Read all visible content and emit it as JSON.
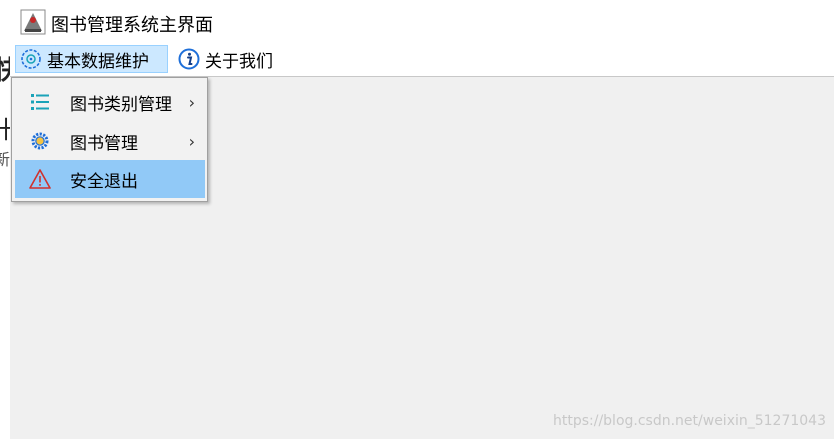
{
  "window": {
    "title": "图书管理系统主界面"
  },
  "menubar": {
    "menus": [
      {
        "label": "基本数据维护",
        "icon": "database-gear-icon"
      },
      {
        "label": "关于我们",
        "icon": "info-icon"
      }
    ]
  },
  "dropdown": {
    "items": [
      {
        "label": "图书类别管理",
        "icon": "list-icon",
        "arrow": "›"
      },
      {
        "label": "图书管理",
        "icon": "gear-icon",
        "arrow": "›"
      },
      {
        "label": "安全退出",
        "icon": "warning-icon"
      }
    ]
  },
  "background_window": {
    "glyphs": [
      "快",
      "十",
      "新"
    ]
  },
  "watermark": "https://blog.csdn.net/weixin_51271043",
  "colors": {
    "menu_active_bg": "#cce8ff",
    "dropdown_hover_bg": "#91c9f7",
    "warning_red": "#d0312d",
    "icon_teal": "#1aa3b8",
    "icon_blue": "#1e6fd9"
  }
}
